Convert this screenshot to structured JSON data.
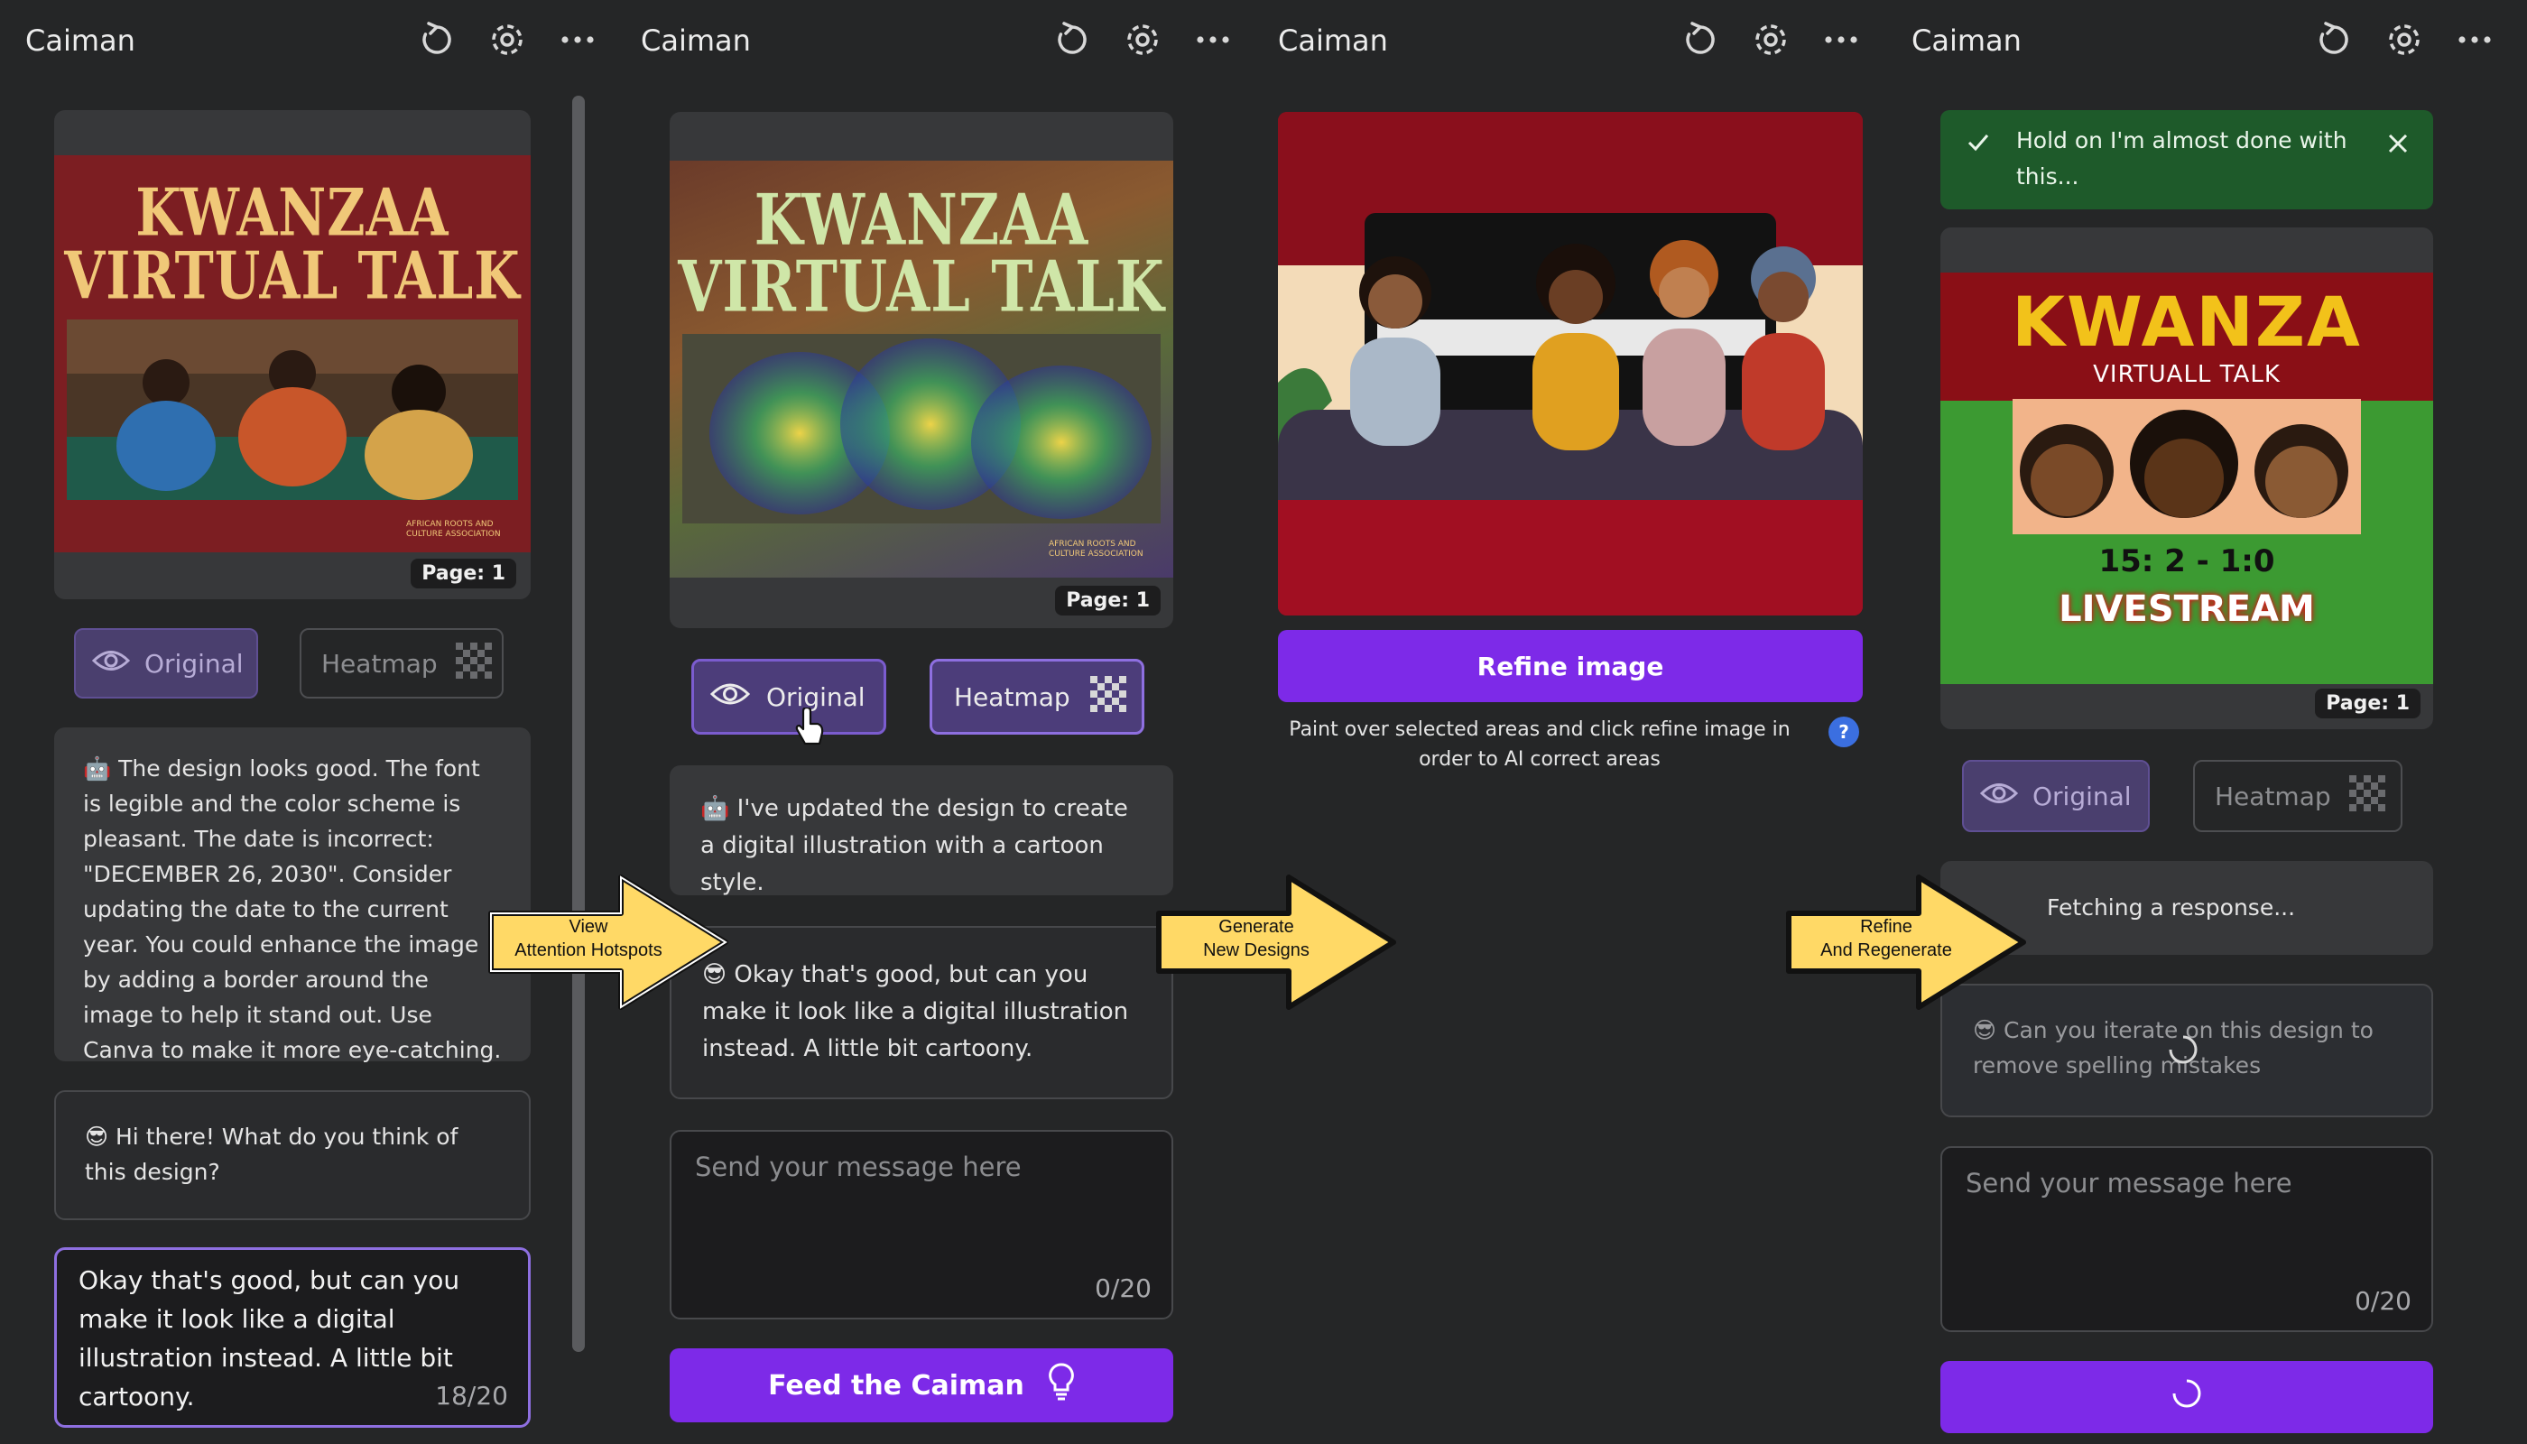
{
  "app_title": "Caiman",
  "page_badge": "Page: 1",
  "poster": {
    "title_line1": "KWANZAA",
    "title_line2": "VIRTUAL TALK",
    "org": "AFRICAN ROOTS AND CULTURE ASSOCIATION"
  },
  "cartoon_poster": {
    "title": "KWANZA",
    "subtitle": "VIRTUALL TALK",
    "date": "15: 2 - 1:0",
    "livestream": "LIVESTREAM"
  },
  "toggle": {
    "original": "Original",
    "heatmap": "Heatmap"
  },
  "panel1": {
    "ai_message": "🤖 The design looks good. The font is legible and the color scheme is pleasant. The date is incorrect: \"DECEMBER 26, 2030\". Consider updating the date to the current year. You could enhance the image by adding a border around the image to help it stand out. Use Canva to make it more eye-catching.",
    "user_message": "😎 Hi there! What do you think of this design?",
    "input_value": "Okay that's good, but can you make it look like a digital illustration instead. A little bit cartoony.",
    "input_count": "18/20"
  },
  "panel2": {
    "ai_message": "🤖 I've updated the design to create a digital illustration with a cartoon style.",
    "user_message": "😎 Okay that's good, but can you make it look like a digital illustration instead. A little bit cartoony.",
    "placeholder": "Send your message here",
    "count": "0/20",
    "cta": "Feed the Caiman"
  },
  "panel3": {
    "refine": "Refine image",
    "hint": "Paint over selected areas and click refine image in order to AI correct areas",
    "help": "?"
  },
  "panel4": {
    "toast": "Hold on I'm almost done with this...",
    "fetching": "Fetching a response...",
    "user_message": "😎 Can you iterate on this design to remove spelling mistakes",
    "placeholder": "Send your message here",
    "count": "0/20"
  },
  "arrows": {
    "a1_l1": "View",
    "a1_l2": "Attention Hotspots",
    "a2_l1": "Generate",
    "a2_l2": "New Designs",
    "a3_l1": "Refine",
    "a3_l2": "And Regenerate"
  },
  "colors": {
    "bg": "#252627",
    "card": "#37383a",
    "accent": "#7d2ae8",
    "toast": "#1e5a2a",
    "arrow": "#ffd966"
  }
}
